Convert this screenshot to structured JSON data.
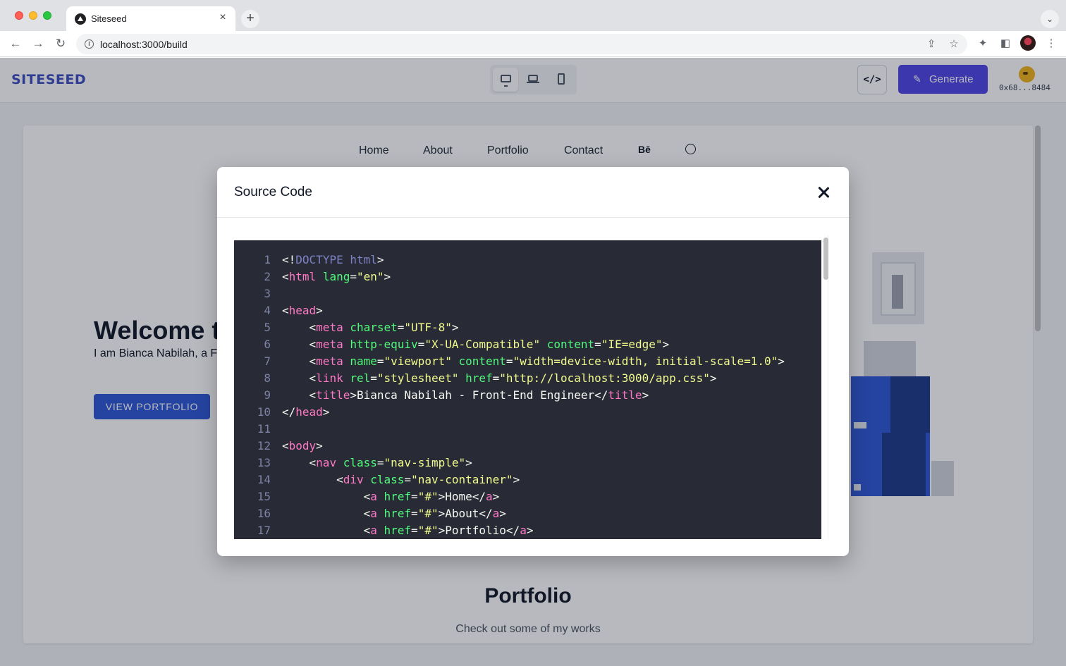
{
  "browser": {
    "tab_title": "Siteseed",
    "url": "localhost:3000/build"
  },
  "app": {
    "logo": "SITESEED",
    "generate_label": "Generate",
    "code_label": "</>",
    "wallet_address": "0x68...8484"
  },
  "preview": {
    "nav": [
      "Home",
      "About",
      "Portfolio",
      "Contact"
    ],
    "behance_label": "Bē",
    "hero_title": "Welcome to",
    "hero_text": "I am Bianca Nabilah, a Fr Design & Code.",
    "cta": "VIEW PORTFOLIO",
    "portfolio_title": "Portfolio",
    "portfolio_sub": "Check out some of my works"
  },
  "modal": {
    "title": "Source Code"
  },
  "code": {
    "line_numbers": [
      "1",
      "2",
      "3",
      "4",
      "5",
      "6",
      "7",
      "8",
      "9",
      "10",
      "11",
      "12",
      "13",
      "14",
      "15",
      "16",
      "17"
    ]
  },
  "colors": {
    "accent": "#4f46e5",
    "cta": "#2f56d4",
    "code_bg": "#282a36"
  }
}
